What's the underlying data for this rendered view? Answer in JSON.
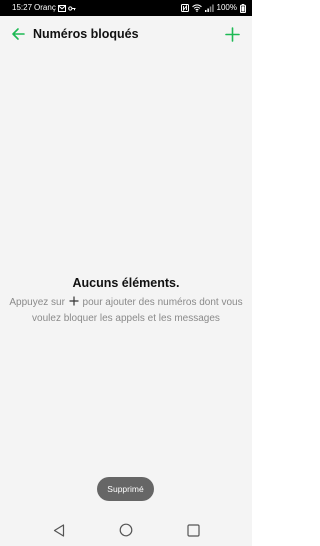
{
  "status_bar": {
    "time": "15:27",
    "carrier": "Oranç",
    "battery": "100%",
    "icons": [
      "mail-icon",
      "vpn-key-icon",
      "nfc-icon",
      "wifi-icon",
      "signal-icon",
      "battery-icon"
    ]
  },
  "toolbar": {
    "title": "Numéros bloqués",
    "back_icon": "arrow-left-icon",
    "add_icon": "plus-icon"
  },
  "empty_state": {
    "title": "Aucuns éléments.",
    "message_before": "Appuyez sur",
    "message_after": "pour ajouter des numéros dont vous voulez bloquer les appels et les messages"
  },
  "toast": {
    "text": "Supprimé"
  },
  "nav_bar": {
    "icons": [
      "back-triangle-icon",
      "home-circle-icon",
      "recents-square-icon"
    ]
  },
  "colors": {
    "accent": "#1db954",
    "background": "#f4f4f4",
    "toast": "#666666"
  }
}
